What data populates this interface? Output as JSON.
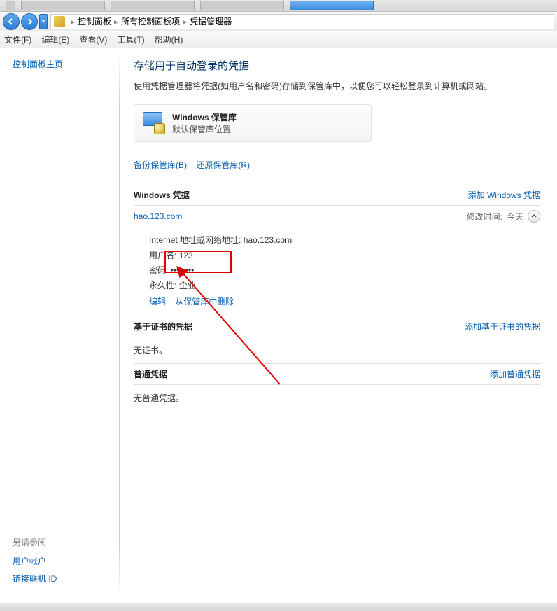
{
  "breadcrumb": {
    "items": [
      "控制面板",
      "所有控制面板项",
      "凭据管理器"
    ]
  },
  "menubar": {
    "file": "文件(F)",
    "edit": "编辑(E)",
    "view": "查看(V)",
    "tools": "工具(T)",
    "help": "帮助(H)"
  },
  "sidebar": {
    "home": "控制面板主页",
    "see_also": "另请参阅",
    "user_accounts": "用户帐户",
    "link_online_id": "链接联机 ID"
  },
  "page": {
    "title": "存储用于自动登录的凭据",
    "desc": "使用凭据管理器将凭据(如用户名和密码)存储到保管库中，以便您可以轻松登录到计算机或网站。"
  },
  "vault": {
    "title": "Windows 保管库",
    "subtitle": "默认保管库位置"
  },
  "actions": {
    "backup": "备份保管库(B)",
    "restore": "还原保管库(R)"
  },
  "sections": {
    "windows": {
      "title": "Windows 凭据",
      "add": "添加 Windows 凭据"
    },
    "cert": {
      "title": "基于证书的凭据",
      "add": "添加基于证书的凭据",
      "empty": "无证书。"
    },
    "generic": {
      "title": "普通凭据",
      "add": "添加普通凭据",
      "empty": "无普通凭据。"
    }
  },
  "credential": {
    "name": "hao.123.com",
    "modified_label": "修改时间:",
    "modified_value": "今天",
    "address_label": "Internet 地址或网络地址:",
    "address_value": "hao.123.com",
    "user_label": "用户名:",
    "user_value": "123",
    "password_label": "密码:",
    "password_value": "••••••••",
    "persist_label": "永久性:",
    "persist_value": "企业",
    "edit": "编辑",
    "remove": "从保管库中删除"
  }
}
